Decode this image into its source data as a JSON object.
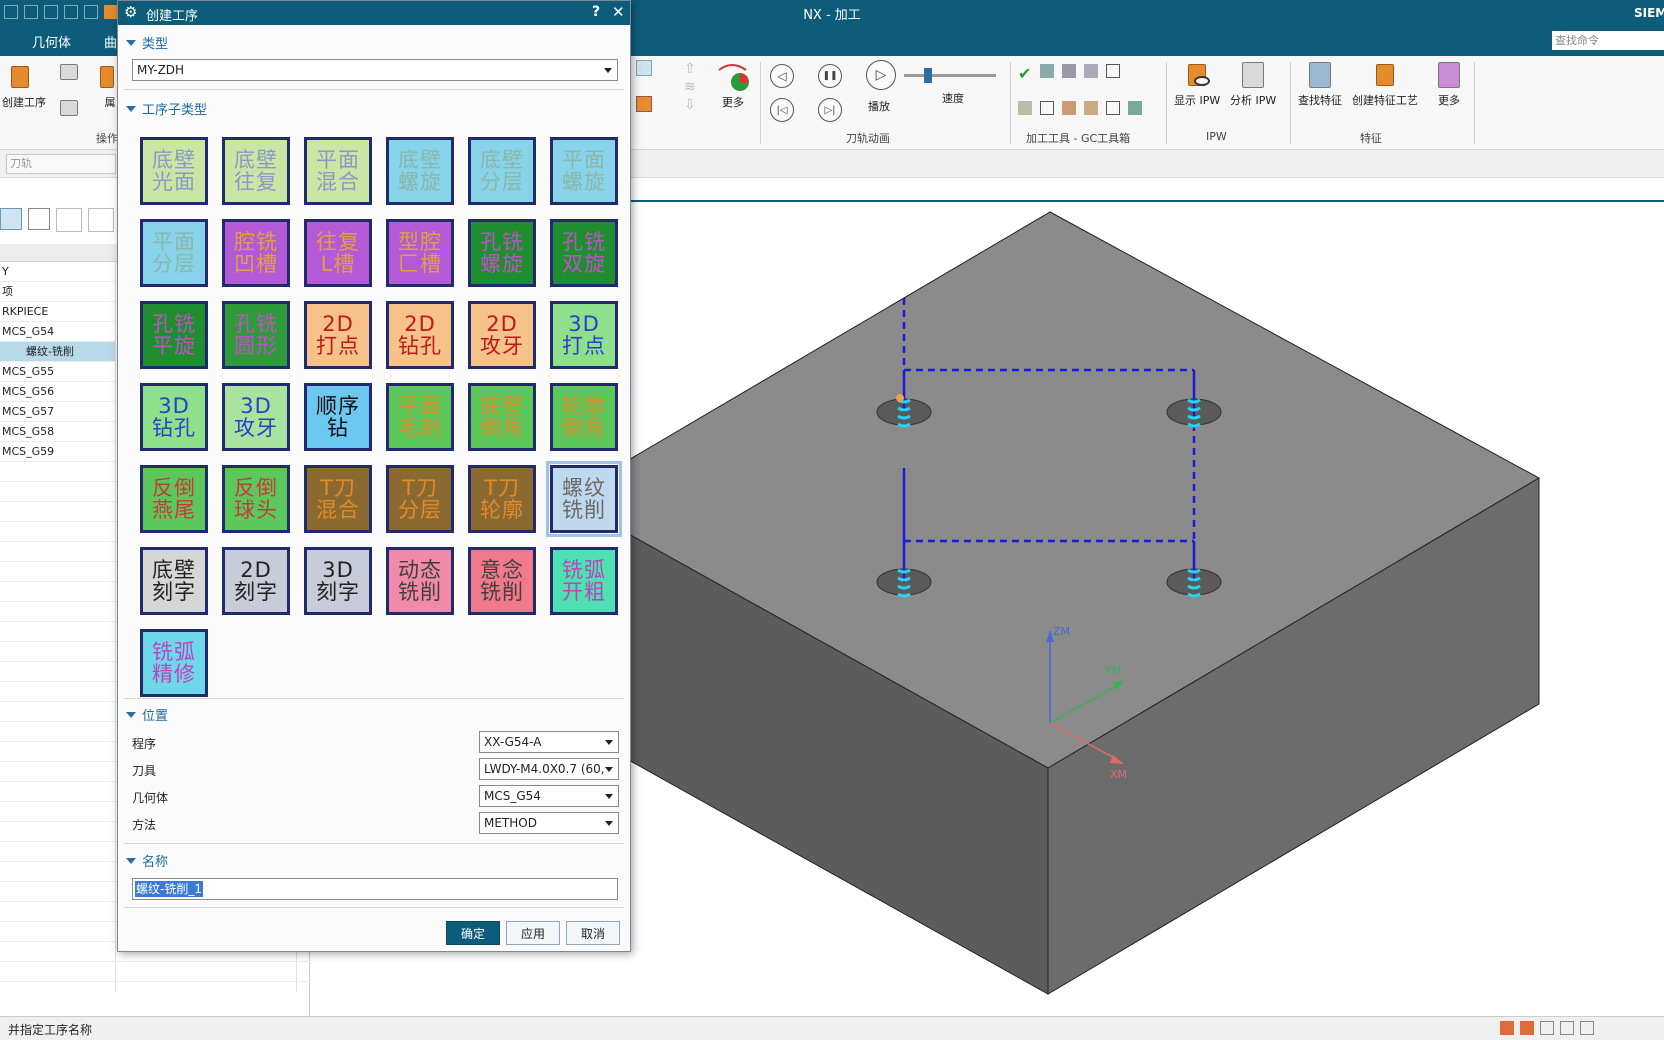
{
  "window": {
    "title": "NX - 加工",
    "brand": "SIEM",
    "search_placeholder": "查找命令"
  },
  "tabs": [
    "几何体",
    "曲"
  ],
  "ribbon": {
    "create_op_label": "创建工序",
    "partial_label_1": "属",
    "ops_group_label": "操作",
    "more_label": "更多",
    "play_label": "播放",
    "speed_label": "速度",
    "toolpath_anim_label": "刀轨动画",
    "gc_toolbox_label": "加工工具 - GC工具箱",
    "show_ipw": "显示 IPW",
    "analyze_ipw": "分析 IPW",
    "ipw_group": "IPW",
    "find_feature": "查找特征",
    "create_feature_process": "创建特征工艺",
    "more2": "更多",
    "feature_group": "特征"
  },
  "filter": {
    "placeholder": "刀轨"
  },
  "nav_tree": {
    "rows": [
      "Y",
      "项",
      "RKPIECE",
      "MCS_G54",
      "螺纹-铣削",
      "MCS_G55",
      "MCS_G56",
      "MCS_G57",
      "MCS_G58",
      "MCS_G59"
    ]
  },
  "dialog": {
    "title": "创建工序",
    "help": "?",
    "close": "✕",
    "type_section": "类型",
    "type_value": "MY-ZDH",
    "subtype_section": "工序子类型",
    "tiles": [
      {
        "text": "底壁光面",
        "bg": "#c9e6a4",
        "fg": "#8a9ac8"
      },
      {
        "text": "底壁往复",
        "bg": "#c9e6a4",
        "fg": "#8a9ac8"
      },
      {
        "text": "平面混合",
        "bg": "#c9e6a4",
        "fg": "#8a9ac8"
      },
      {
        "text": "底壁螺旋",
        "bg": "#86d3ea",
        "fg": "#8bb8a8"
      },
      {
        "text": "底壁分层",
        "bg": "#86d3ea",
        "fg": "#8bb8a8"
      },
      {
        "text": "平面螺旋",
        "bg": "#86d3ea",
        "fg": "#8bb8a8"
      },
      {
        "text": "平面分层",
        "bg": "#86d3ea",
        "fg": "#8bb8a8"
      },
      {
        "text": "腔铣凹槽",
        "bg": "#b45ad6",
        "fg": "#e0a040"
      },
      {
        "text": "往复L槽",
        "bg": "#b45ad6",
        "fg": "#e0a040"
      },
      {
        "text": "型腔匚槽",
        "bg": "#b45ad6",
        "fg": "#e0a040"
      },
      {
        "text": "孔铣螺旋",
        "bg": "#1e8e2e",
        "fg": "#c050c8"
      },
      {
        "text": "孔铣双旋",
        "bg": "#1e8e2e",
        "fg": "#c050c8"
      },
      {
        "text": "孔铣平旋",
        "bg": "#1e8e2e",
        "fg": "#c050c8"
      },
      {
        "text": "孔铣圆形",
        "bg": "#2e9a3a",
        "fg": "#c050c8"
      },
      {
        "text": "2D打点",
        "bg": "#f7c28a",
        "fg": "#c01818"
      },
      {
        "text": "2D钻孔",
        "bg": "#f7c28a",
        "fg": "#c01818"
      },
      {
        "text": "2D攻牙",
        "bg": "#f7c28a",
        "fg": "#c01818"
      },
      {
        "text": "3D打点",
        "bg": "#8fe08a",
        "fg": "#2a40c8"
      },
      {
        "text": "3D钻孔",
        "bg": "#8fe08a",
        "fg": "#2a40c8"
      },
      {
        "text": "3D攻牙",
        "bg": "#a8e4a0",
        "fg": "#2a40c8"
      },
      {
        "text": "顺序钻",
        "bg": "#6cc8f0",
        "fg": "#111111"
      },
      {
        "text": "平面毛刺",
        "bg": "#5cc85c",
        "fg": "#e08a2a"
      },
      {
        "text": "底壁倒角",
        "bg": "#5cc85c",
        "fg": "#e08a2a"
      },
      {
        "text": "轮廓倒角",
        "bg": "#5cc85c",
        "fg": "#e08a2a"
      },
      {
        "text": "反倒燕尾",
        "bg": "#5cc85c",
        "fg": "#c83a3a"
      },
      {
        "text": "反倒球头",
        "bg": "#5cc85c",
        "fg": "#c83a3a"
      },
      {
        "text": "T刀混合",
        "bg": "#8a6a30",
        "fg": "#e08a2a"
      },
      {
        "text": "T刀分层",
        "bg": "#8a6a30",
        "fg": "#e08a2a"
      },
      {
        "text": "T刀轮廓",
        "bg": "#8a6a30",
        "fg": "#e08a2a"
      },
      {
        "text": "螺纹铣削",
        "bg": "#c0d8ee",
        "fg": "#6a6a6a"
      },
      {
        "text": "底壁刻字",
        "bg": "#d6d6d6",
        "fg": "#222222"
      },
      {
        "text": "2D刻字",
        "bg": "#c8ccd8",
        "fg": "#222222"
      },
      {
        "text": "3D刻字",
        "bg": "#c8ccd8",
        "fg": "#222222"
      },
      {
        "text": "动态铣削",
        "bg": "#f08aa8",
        "fg": "#404040"
      },
      {
        "text": "意念铣削",
        "bg": "#f07a8a",
        "fg": "#404040"
      },
      {
        "text": "铣弧开粗",
        "bg": "#4ee0b0",
        "fg": "#c040c0"
      },
      {
        "text": "铣弧精修",
        "bg": "#6ed8e8",
        "fg": "#c040c0"
      }
    ],
    "position_section": "位置",
    "program_label": "程序",
    "program_value": "XX-G54-A",
    "tool_label": "刀具",
    "tool_value": "LWDY-M4.0X0.7 (60,",
    "geometry_label": "几何体",
    "geometry_value": "MCS_G54",
    "method_label": "方法",
    "method_value": "METHOD",
    "name_section": "名称",
    "name_value": "螺纹-铣削_1",
    "ok": "确定",
    "apply": "应用",
    "cancel": "取消"
  },
  "axes": {
    "zm": "ZM",
    "ym": "YM",
    "xm": "XM"
  },
  "status": {
    "text": "并指定工序名称"
  },
  "colors": {
    "accent": "#0d5c7a",
    "toolpath": "#1a1ad8",
    "model_top": "#8c8c8c",
    "model_left": "#5e5e5e",
    "model_right": "#6e6e6e"
  }
}
